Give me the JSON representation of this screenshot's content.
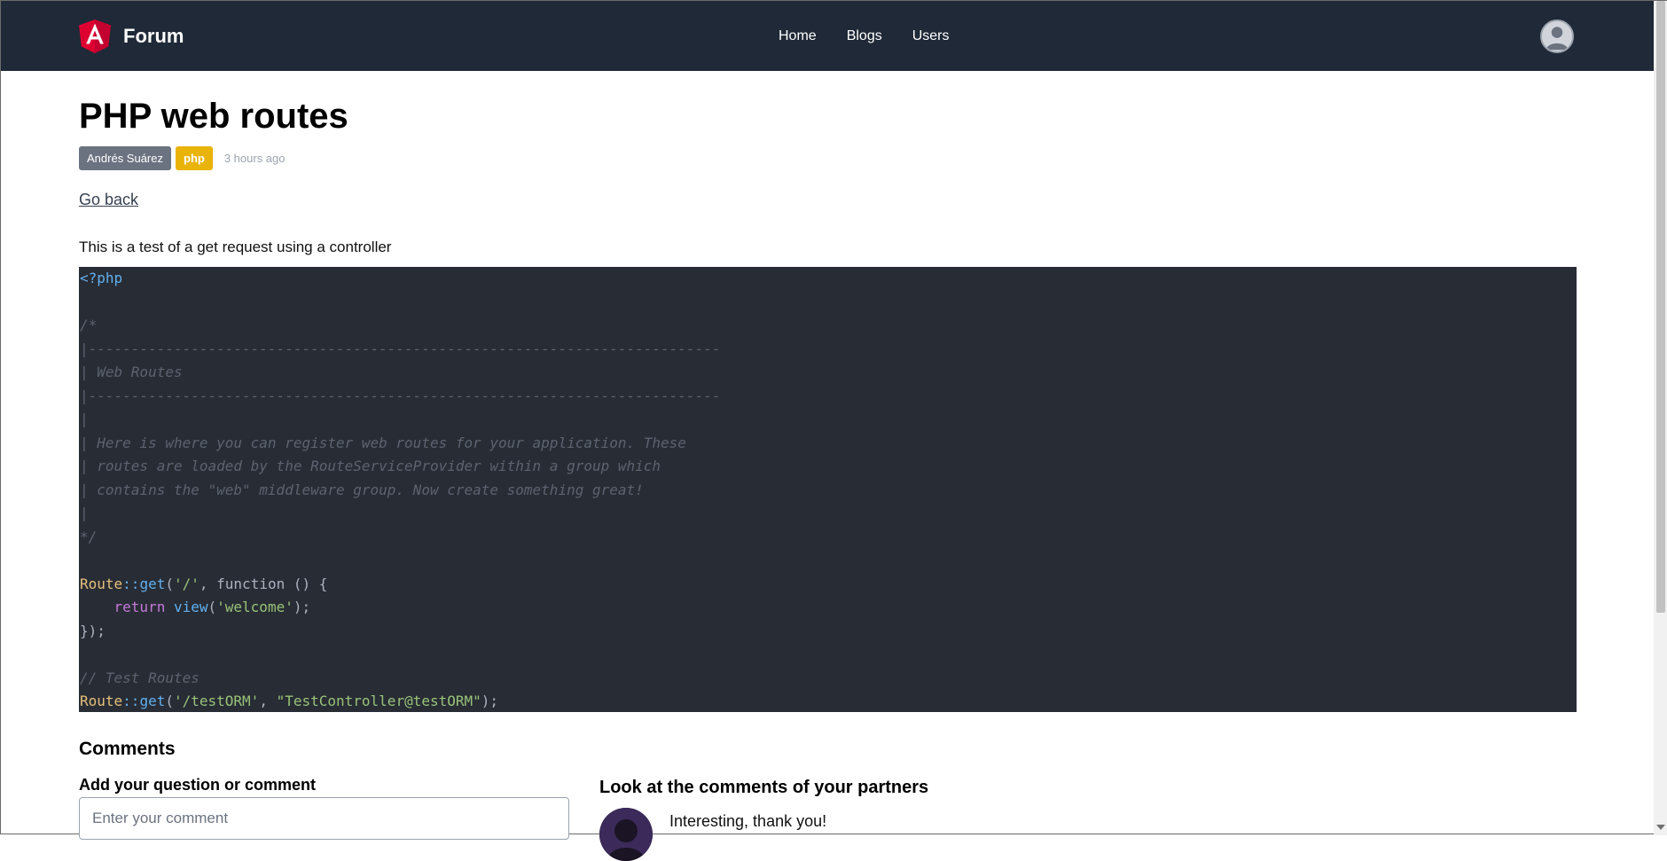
{
  "navbar": {
    "brand": "Forum",
    "links": [
      "Home",
      "Blogs",
      "Users"
    ],
    "logo_icon": "angular-logo-icon",
    "avatar_icon": "user-avatar-icon"
  },
  "post": {
    "title": "PHP web routes",
    "author": "Andrés Suárez",
    "tag": "php",
    "time": "3 hours ago",
    "go_back": "Go back",
    "description": "This is a test of a get request using a controller"
  },
  "code": {
    "language": "php",
    "lines": [
      "<?php",
      "",
      "/*",
      "|--------------------------------------------------------------------------",
      "| Web Routes",
      "|--------------------------------------------------------------------------",
      "|",
      "| Here is where you can register web routes for your application. These",
      "| routes are loaded by the RouteServiceProvider within a group which",
      "| contains the \"web\" middleware group. Now create something great!",
      "|",
      "*/",
      "",
      "Route::get('/', function () {",
      "    return view('welcome');",
      "});",
      "",
      "// Test Routes",
      "Route::get('/testORM', \"TestController@testORM\");"
    ]
  },
  "comments": {
    "heading": "Comments",
    "add_label": "Add your question or comment",
    "input_placeholder": "Enter your comment",
    "partners_heading": "Look at the comments of your partners",
    "items": [
      {
        "text": "Interesting, thank you!"
      }
    ]
  },
  "colors": {
    "navbar_bg": "#1f2937",
    "code_bg": "#282c34",
    "tag_badge": "#eab308",
    "author_badge": "#6b7280"
  }
}
